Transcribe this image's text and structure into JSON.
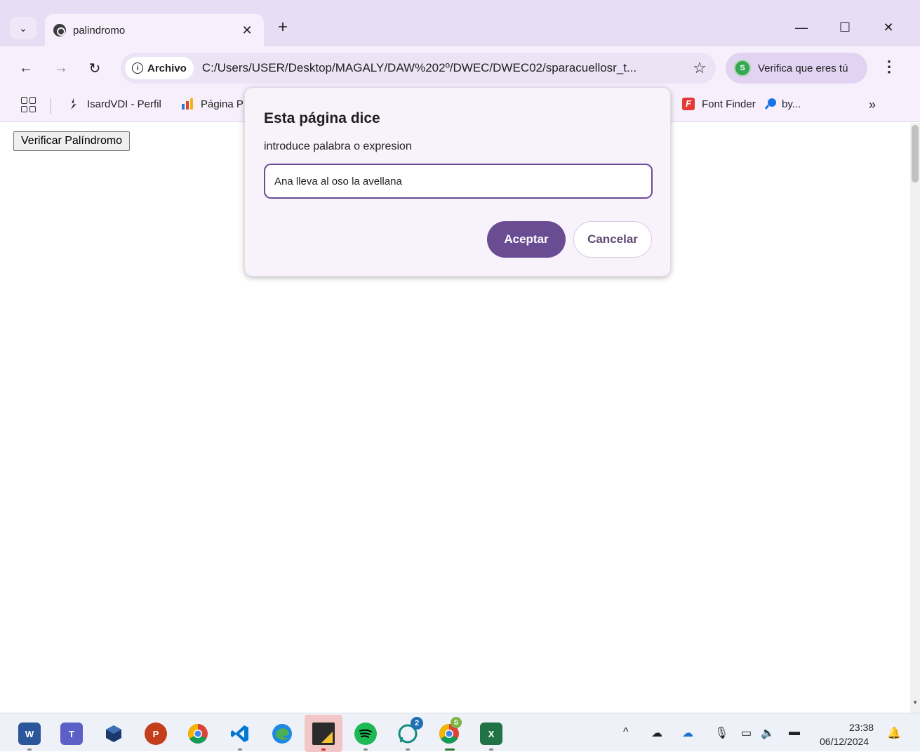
{
  "browser": {
    "tab": {
      "title": "palindromo",
      "close": "✕"
    },
    "new_tab": "+",
    "window": {
      "minimize": "—",
      "maximize": "☐",
      "close": "✕"
    },
    "address": {
      "chip": "Archivo",
      "url": "C:/Users/USER/Desktop/MAGALY/DAW%202º/DWEC/DWEC02/sparacuellosr_t..."
    },
    "profile": {
      "avatar": "S",
      "label": "Verifica que eres tú"
    },
    "bookmarks": [
      {
        "label": "IsardVDI - Perfil"
      },
      {
        "label": "Página P"
      },
      {
        "label": "Font Finder"
      },
      {
        "label": "by..."
      }
    ],
    "bookmarks_more": "»"
  },
  "page": {
    "button_label": "Verificar Palíndromo"
  },
  "dialog": {
    "title": "Esta página dice",
    "message": "introduce palabra o expresion",
    "input_value": "Ana lleva al oso la avellana",
    "accept": "Aceptar",
    "cancel": "Cancelar"
  },
  "taskbar": {
    "whatsapp_badge": "2",
    "chrome_badge": "S",
    "time": "23:38",
    "date": "06/12/2024"
  },
  "colors": {
    "accent": "#6a4c93",
    "tab_strip": "#e9ddf5",
    "toolbar": "#f7f0fc"
  }
}
